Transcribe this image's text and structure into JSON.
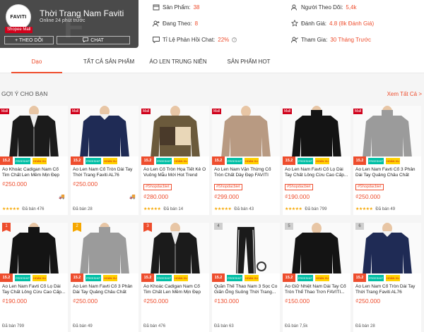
{
  "shop": {
    "logo_text": "FAVITI",
    "mall_label": "Shopee Mall",
    "name": "Thời Trang Nam Faviti",
    "status": "Online 24 phút trước",
    "follow_label": "+ THEO DÕI",
    "chat_label": "CHAT"
  },
  "stats": {
    "products_label": "Sản Phẩm:",
    "products_value": "38",
    "following_label": "Đang Theo:",
    "following_value": "8",
    "response_label": "Tỉ Lệ Phản Hồi Chat:",
    "response_value": "22%",
    "followers_label": "Người Theo Dõi:",
    "followers_value": "5,4k",
    "rating_label": "Đánh Giá:",
    "rating_value": "4.8 (8k Đánh Giá)",
    "joined_label": "Tham Gia:",
    "joined_value": "30 Tháng Trước"
  },
  "nav": {
    "tabs": [
      "Dạo",
      "TẤT CẢ SẢN PHẨM",
      "ÁO LEN TRUNG NIÊN",
      "SẢN PHẨM HOT"
    ]
  },
  "section": {
    "title": "GỢI Ý CHO BẠN",
    "see_all": "Xem Tất Cả >"
  },
  "promo": {
    "date": "15.2",
    "ship": "FREESHIP XTRA",
    "hoan": "HOÀN XU XTRA"
  },
  "products": [
    {
      "badge": "Mall",
      "rank": "",
      "name": "Áo Khoác Cadigan Nam Cổ Tim Chất Len Mềm Mịn Đẹp Thời...",
      "tag": "",
      "price": "₫250.000",
      "stars": "★★★★★",
      "sold": "Đã bán 476",
      "color": "#1b1b1b",
      "style": "cardigan",
      "truck": "true"
    },
    {
      "badge": "Mall",
      "rank": "",
      "name": "Áo Len Nam Cổ Tròn Dài Tay Thời Trang Faviti AL76",
      "tag": "",
      "price": "₫250.000",
      "stars": "",
      "sold": "Đã bán 28",
      "color": "#1f2b55",
      "style": "sweater",
      "truck": "true"
    },
    {
      "badge": "Mall",
      "rank": "",
      "name": "Áo Len Cổ Tròn Họa Tiết Kẻ Ô Vuông Mẫu Mới Hot Trend 20...",
      "tag": "#Shopdacbiet",
      "price": "₫280.000",
      "stars": "★★★★★",
      "sold": "Đã bán 14",
      "color": "#6b5a3c",
      "style": "block",
      "truck": ""
    },
    {
      "badge": "Mall",
      "rank": "",
      "name": "Áo Len Nam Vặn Thừng Cổ Tròn Chất Dày Đẹp FAVITI AL81",
      "tag": "#Shopdacbiet",
      "price": "₫299.000",
      "stars": "★★★★★",
      "sold": "Đã bán 43",
      "color": "#b89a82",
      "style": "cable",
      "truck": ""
    },
    {
      "badge": "Mall",
      "rank": "",
      "name": "Áo Len Nam Favti Cổ Lọ Dài Tay Chất Lông Cừu Cao Cấp...",
      "tag": "#Shopdacbiet",
      "price": "₫190.000",
      "stars": "★★★★★",
      "sold": "Đã bán 799",
      "color": "#141414",
      "style": "turtle",
      "truck": ""
    },
    {
      "badge": "Mall",
      "rank": "",
      "name": "Áo Len Nam Favti Cổ 3 Phân Dài Tay Quảng Châu Chất Đẹ...",
      "tag": "#Shopdacbiet",
      "price": "₫250.000",
      "stars": "★★★★★",
      "sold": "Đã bán 49",
      "color": "#9b9b9b",
      "style": "turtle",
      "truck": ""
    },
    {
      "badge": "",
      "rank": "1",
      "name": "Áo Len Nam Favti Cổ Lọ Dài Tay Chất Lông Cừu Cao Cấp...",
      "tag": "",
      "price": "₫190.000",
      "stars": "",
      "sold": "Đã bán 799",
      "color": "#141414",
      "style": "turtle",
      "truck": ""
    },
    {
      "badge": "",
      "rank": "2",
      "name": "Áo Len Nam Favti Cổ 3 Phân Dài Tay Quảng Châu Chất Đẹp...",
      "tag": "",
      "price": "₫250.000",
      "stars": "",
      "sold": "Đã bán 49",
      "color": "#9b9b9b",
      "style": "turtle",
      "truck": ""
    },
    {
      "badge": "",
      "rank": "3",
      "name": "Áo Khoác Cadigan Nam Cổ Tim Chất Len Mềm Mịn Đẹp Thời...",
      "tag": "",
      "price": "₫250.000",
      "stars": "",
      "sold": "Đã bán 476",
      "color": "#1b1b1b",
      "style": "cardigan",
      "truck": ""
    },
    {
      "badge": "",
      "rank": "4",
      "name": "Quần Thể Thao Nam 3 Sọc Co Giãn Ống Suông Thời Trang...",
      "tag": "",
      "price": "₫130.000",
      "stars": "",
      "sold": "Đã bán 63",
      "color": "#1b1b1b",
      "style": "pants",
      "truck": ""
    },
    {
      "badge": "",
      "rank": "5",
      "name": "Áo Giữ Nhiệt Nam Dài Tay Cổ Tròn Thể Thao Trơn FAVITI...",
      "tag": "",
      "price": "₫150.000",
      "stars": "",
      "sold": "Đã bán 7,5k",
      "color": "#141414",
      "style": "tee",
      "truck": ""
    },
    {
      "badge": "",
      "rank": "6",
      "name": "Áo Len Nam Cổ Tròn Dài Tay Thời Trang Faviti AL76",
      "tag": "",
      "price": "₫250.000",
      "stars": "",
      "sold": "Đã bán 28",
      "color": "#1f2b55",
      "style": "sweater",
      "truck": ""
    }
  ]
}
